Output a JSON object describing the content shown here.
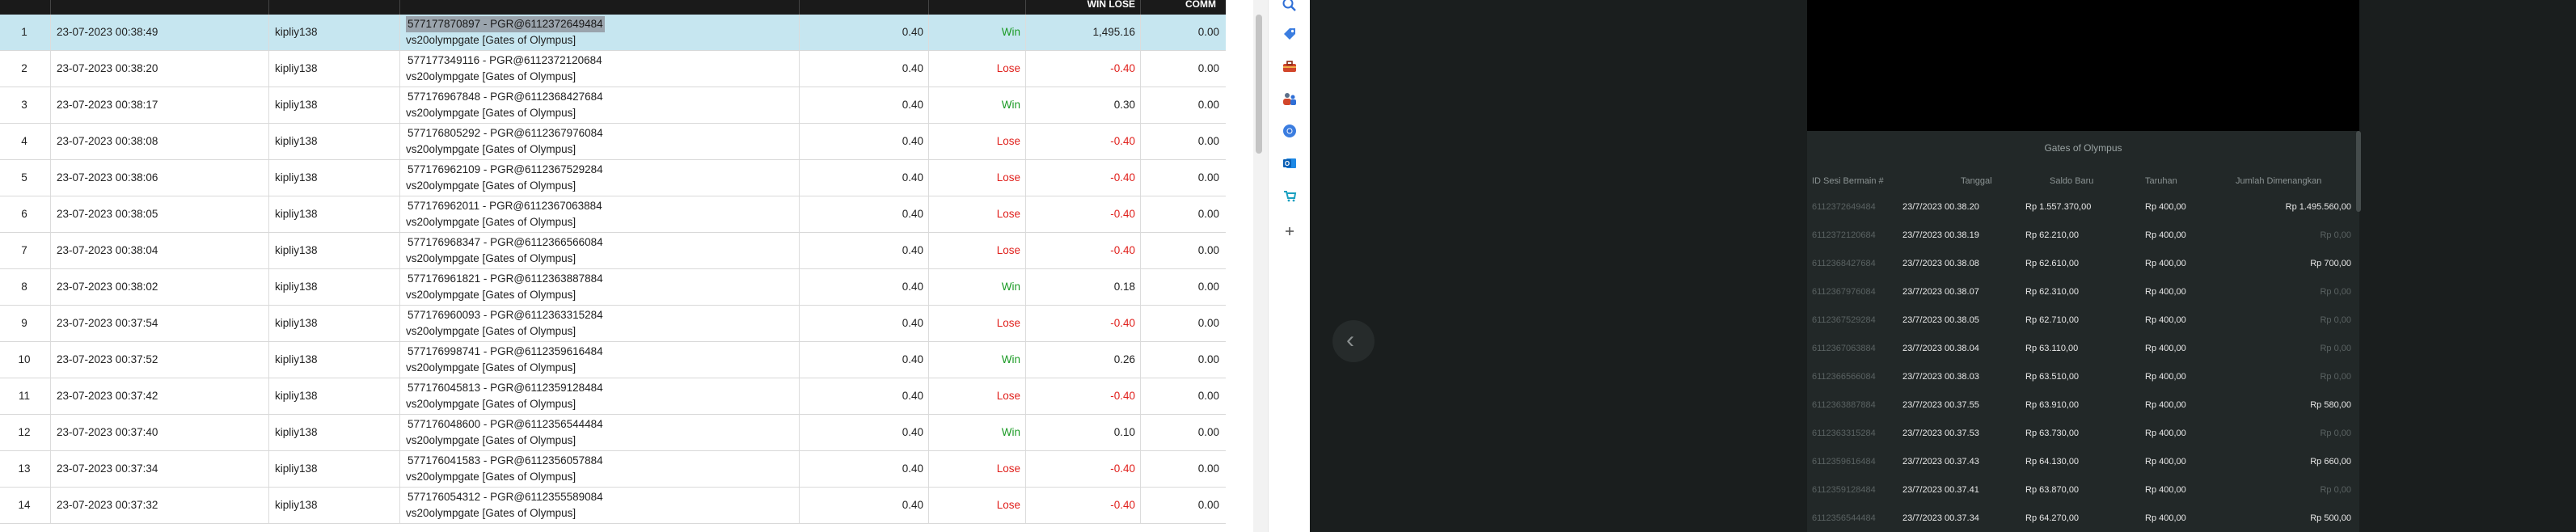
{
  "table": {
    "headers": {
      "win_lose": "WIN LOSE",
      "comm": "COMM"
    },
    "rows": [
      {
        "no": "1",
        "date": "23-07-2023 00:38:49",
        "user": "kipliy138",
        "desc1": "577177870897 - PGR@6112372649484",
        "desc2": "vs20olympgate [Gates of Olympus]",
        "stake": "0.40",
        "result": "Win",
        "winlose": "1,495.16",
        "comm": "0.00"
      },
      {
        "no": "2",
        "date": "23-07-2023 00:38:20",
        "user": "kipliy138",
        "desc1": "577177349116 - PGR@6112372120684",
        "desc2": "vs20olympgate [Gates of Olympus]",
        "stake": "0.40",
        "result": "Lose",
        "winlose": "-0.40",
        "comm": "0.00"
      },
      {
        "no": "3",
        "date": "23-07-2023 00:38:17",
        "user": "kipliy138",
        "desc1": "577176967848 - PGR@6112368427684",
        "desc2": "vs20olympgate [Gates of Olympus]",
        "stake": "0.40",
        "result": "Win",
        "winlose": "0.30",
        "comm": "0.00"
      },
      {
        "no": "4",
        "date": "23-07-2023 00:38:08",
        "user": "kipliy138",
        "desc1": "577176805292 - PGR@6112367976084",
        "desc2": "vs20olympgate [Gates of Olympus]",
        "stake": "0.40",
        "result": "Lose",
        "winlose": "-0.40",
        "comm": "0.00"
      },
      {
        "no": "5",
        "date": "23-07-2023 00:38:06",
        "user": "kipliy138",
        "desc1": "577176962109 - PGR@6112367529284",
        "desc2": "vs20olympgate [Gates of Olympus]",
        "stake": "0.40",
        "result": "Lose",
        "winlose": "-0.40",
        "comm": "0.00"
      },
      {
        "no": "6",
        "date": "23-07-2023 00:38:05",
        "user": "kipliy138",
        "desc1": "577176962011 - PGR@6112367063884",
        "desc2": "vs20olympgate [Gates of Olympus]",
        "stake": "0.40",
        "result": "Lose",
        "winlose": "-0.40",
        "comm": "0.00"
      },
      {
        "no": "7",
        "date": "23-07-2023 00:38:04",
        "user": "kipliy138",
        "desc1": "577176968347 - PGR@6112366566084",
        "desc2": "vs20olympgate [Gates of Olympus]",
        "stake": "0.40",
        "result": "Lose",
        "winlose": "-0.40",
        "comm": "0.00"
      },
      {
        "no": "8",
        "date": "23-07-2023 00:38:02",
        "user": "kipliy138",
        "desc1": "577176961821 - PGR@6112363887884",
        "desc2": "vs20olympgate [Gates of Olympus]",
        "stake": "0.40",
        "result": "Win",
        "winlose": "0.18",
        "comm": "0.00"
      },
      {
        "no": "9",
        "date": "23-07-2023 00:37:54",
        "user": "kipliy138",
        "desc1": "577176960093 - PGR@6112363315284",
        "desc2": "vs20olympgate [Gates of Olympus]",
        "stake": "0.40",
        "result": "Lose",
        "winlose": "-0.40",
        "comm": "0.00"
      },
      {
        "no": "10",
        "date": "23-07-2023 00:37:52",
        "user": "kipliy138",
        "desc1": "577176998741 - PGR@6112359616484",
        "desc2": "vs20olympgate [Gates of Olympus]",
        "stake": "0.40",
        "result": "Win",
        "winlose": "0.26",
        "comm": "0.00"
      },
      {
        "no": "11",
        "date": "23-07-2023 00:37:42",
        "user": "kipliy138",
        "desc1": "577176045813 - PGR@6112359128484",
        "desc2": "vs20olympgate [Gates of Olympus]",
        "stake": "0.40",
        "result": "Lose",
        "winlose": "-0.40",
        "comm": "0.00"
      },
      {
        "no": "12",
        "date": "23-07-2023 00:37:40",
        "user": "kipliy138",
        "desc1": "577176048600 - PGR@6112356544484",
        "desc2": "vs20olympgate [Gates of Olympus]",
        "stake": "0.40",
        "result": "Win",
        "winlose": "0.10",
        "comm": "0.00"
      },
      {
        "no": "13",
        "date": "23-07-2023 00:37:34",
        "user": "kipliy138",
        "desc1": "577176041583 - PGR@6112356057884",
        "desc2": "vs20olympgate [Gates of Olympus]",
        "stake": "0.40",
        "result": "Lose",
        "winlose": "-0.40",
        "comm": "0.00"
      },
      {
        "no": "14",
        "date": "23-07-2023 00:37:32",
        "user": "kipliy138",
        "desc1": "577176054312 - PGR@6112355589084",
        "desc2": "vs20olympgate [Gates of Olympus]",
        "stake": "0.40",
        "result": "Lose",
        "winlose": "-0.40",
        "comm": "0.00"
      }
    ]
  },
  "icon_strip": {
    "icons": [
      "search-icon",
      "tag-icon",
      "toolbox-icon",
      "people-icon",
      "chrome-icon",
      "outlook-icon",
      "shopping-icon",
      "plus-icon"
    ]
  },
  "game": {
    "back_icon": "chevron-left-icon",
    "history": {
      "title": "Gates of Olympus",
      "headers": {
        "id": "ID Sesi Bermain #",
        "date": "Tanggal",
        "balance": "Saldo Baru",
        "bet": "Taruhan",
        "win": "Jumlah Dimenangkan"
      },
      "rows": [
        {
          "id": "6112372649484",
          "date": "23/7/2023 00.38.20",
          "balance": "Rp 1.557.370,00",
          "bet": "Rp 400,00",
          "win": "Rp 1.495.560,00"
        },
        {
          "id": "6112372120684",
          "date": "23/7/2023 00.38.19",
          "balance": "Rp 62.210,00",
          "bet": "Rp 400,00",
          "win": "Rp 0,00"
        },
        {
          "id": "6112368427684",
          "date": "23/7/2023 00.38.08",
          "balance": "Rp 62.610,00",
          "bet": "Rp 400,00",
          "win": "Rp 700,00"
        },
        {
          "id": "6112367976084",
          "date": "23/7/2023 00.38.07",
          "balance": "Rp 62.310,00",
          "bet": "Rp 400,00",
          "win": "Rp 0,00"
        },
        {
          "id": "6112367529284",
          "date": "23/7/2023 00.38.05",
          "balance": "Rp 62.710,00",
          "bet": "Rp 400,00",
          "win": "Rp 0,00"
        },
        {
          "id": "6112367063884",
          "date": "23/7/2023 00.38.04",
          "balance": "Rp 63.110,00",
          "bet": "Rp 400,00",
          "win": "Rp 0,00"
        },
        {
          "id": "6112366566084",
          "date": "23/7/2023 00.38.03",
          "balance": "Rp 63.510,00",
          "bet": "Rp 400,00",
          "win": "Rp 0,00"
        },
        {
          "id": "6112363887884",
          "date": "23/7/2023 00.37.55",
          "balance": "Rp 63.910,00",
          "bet": "Rp 400,00",
          "win": "Rp 580,00"
        },
        {
          "id": "6112363315284",
          "date": "23/7/2023 00.37.53",
          "balance": "Rp 63.730,00",
          "bet": "Rp 400,00",
          "win": "Rp 0,00"
        },
        {
          "id": "6112359616484",
          "date": "23/7/2023 00.37.43",
          "balance": "Rp 64.130,00",
          "bet": "Rp 400,00",
          "win": "Rp 660,00"
        },
        {
          "id": "6112359128484",
          "date": "23/7/2023 00.37.41",
          "balance": "Rp 63.870,00",
          "bet": "Rp 400,00",
          "win": "Rp 0,00"
        },
        {
          "id": "6112356544484",
          "date": "23/7/2023 00.37.34",
          "balance": "Rp 64.270,00",
          "bet": "Rp 400,00",
          "win": "Rp 500,00"
        }
      ]
    }
  },
  "colors": {
    "win": "#1a9a24",
    "lose": "#e0201c",
    "selected_row": "#c6e6f0",
    "dark_bg": "#1a1e1e"
  }
}
